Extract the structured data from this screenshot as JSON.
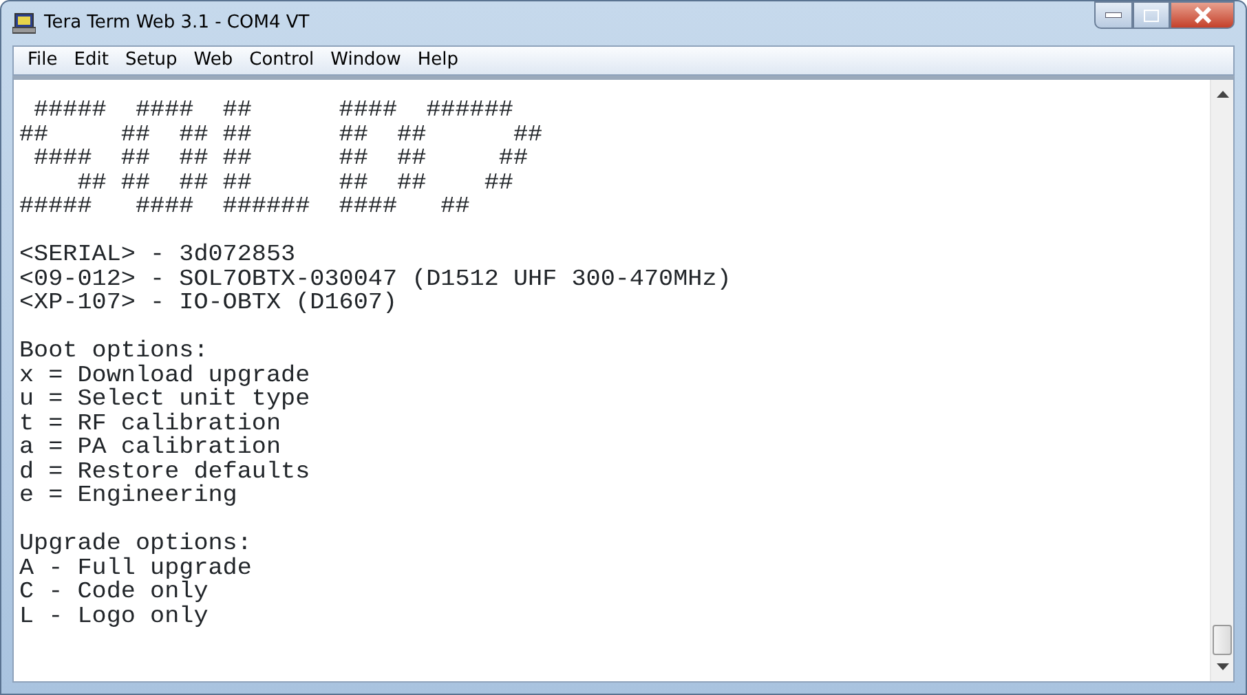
{
  "window": {
    "title": "Tera Term Web 3.1 - COM4 VT"
  },
  "menu": [
    "File",
    "Edit",
    "Setup",
    "Web",
    "Control",
    "Window",
    "Help"
  ],
  "terminal": {
    "blocks": [
      [
        " #####  ####  ##      ####  ######",
        "##     ##  ## ##      ##  ##      ##",
        " ####  ##  ## ##      ##  ##     ##",
        "    ## ##  ## ##      ##  ##    ##",
        "#####   ####  ######  ####   ##"
      ],
      [
        "<SERIAL> - 3d072853",
        "<09-012> - SOL7OBTX-030047 (D1512 UHF 300-470MHz)",
        "<XP-107> - IO-OBTX (D1607)"
      ],
      [
        "Boot options:",
        "x = Download upgrade",
        "u = Select unit type",
        "t = RF calibration",
        "a = PA calibration",
        "d = Restore defaults",
        "e = Engineering"
      ],
      [
        "Upgrade options:",
        "A - Full upgrade",
        "C - Code only",
        "L - Logo only"
      ]
    ]
  }
}
